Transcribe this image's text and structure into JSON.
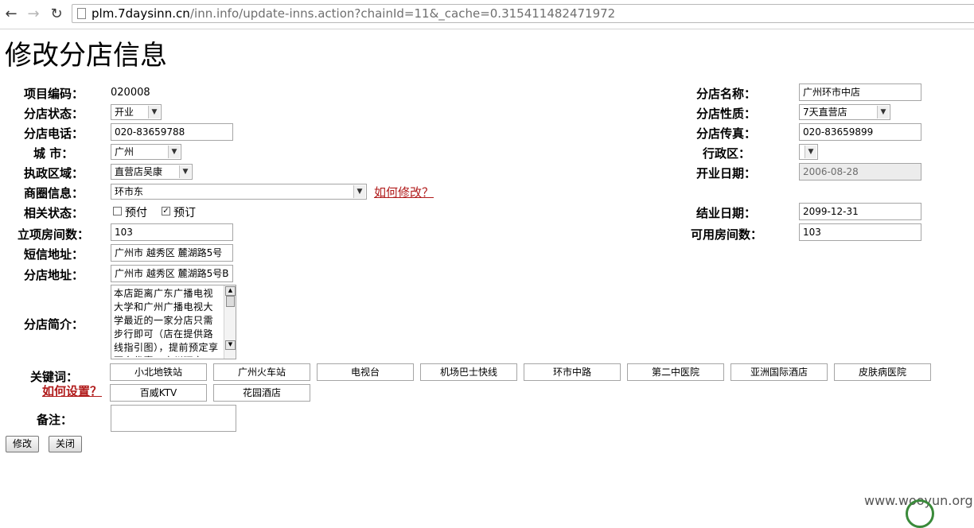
{
  "browser": {
    "url_host": "plm.7daysinn.cn",
    "url_path": "/inn.info/update-inns.action?chainId=11&_cache=0.315411482471972"
  },
  "page": {
    "title": "修改分店信息"
  },
  "form": {
    "project_code_label": "项目编码：",
    "project_code_value": "020008",
    "status_label": "分店状态：",
    "status_value": "开业",
    "phone_label": "分店电话：",
    "phone_value": "020-83659788",
    "city_label": "城  市：",
    "city_value": "广州",
    "district_area_label": "执政区域：",
    "district_area_value": "直营店吴康",
    "business_circle_label": "商圈信息：",
    "business_circle_value": "环市东",
    "how_to_edit_link": "如何修改？",
    "related_status_label": "相关状态：",
    "prepay_label": "预付",
    "booking_label": "预订",
    "approved_rooms_label": "立项房间数：",
    "approved_rooms_value": "103",
    "sms_address_label": "短信地址：",
    "sms_address_value": "广州市 越秀区 麓湖路5号",
    "address_label": "分店地址：",
    "address_value": "广州市 越秀区 麓湖路5号B",
    "intro_label": "分店简介：",
    "intro_value": "本店距离广东广播电视大学和广州广播电视大学最近的一家分店只需步行即可（店在提供路线指引图），提前预定享更多优惠。广州环市",
    "keywords_label": "关键词：",
    "how_to_set_link": "如何设置？",
    "keywords": [
      "小北地铁站",
      "广州火车站",
      "电视台",
      "机场巴士快线",
      "环市中路",
      "第二中医院",
      "亚洲国际酒店",
      "皮肤病医院",
      "百威KTV",
      "花园酒店"
    ],
    "remark_label": "备注：",
    "remark_value": "",
    "name_label": "分店名称：",
    "name_value": "广州环市中店",
    "nature_label": "分店性质：",
    "nature_value": "7天直营店",
    "fax_label": "分店传真：",
    "fax_value": "020-83659899",
    "admin_district_label": "行政区：",
    "admin_district_value": "",
    "open_date_label": "开业日期：",
    "open_date_value": "2006-08-28",
    "end_date_label": "结业日期：",
    "end_date_value": "2099-12-31",
    "available_rooms_label": "可用房间数：",
    "available_rooms_value": "103"
  },
  "buttons": {
    "modify": "修改",
    "close": "关闭"
  },
  "watermark": "www.wooyun.org",
  "colors": {
    "link": "#b01a1a",
    "watermark_logo": "#3a8a3a"
  }
}
